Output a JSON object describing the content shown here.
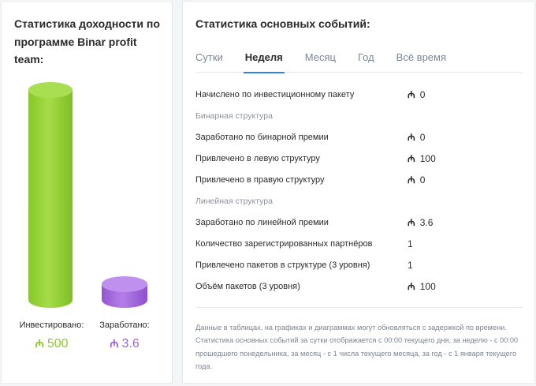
{
  "left": {
    "title": "Статистика доходности по программе Binar profit team:",
    "invested": {
      "label": "Инвестировано:",
      "value": "500",
      "color": "#8ccc2c"
    },
    "earned": {
      "label": "Заработано:",
      "value": "3.6",
      "color": "#a064d8"
    },
    "currency_symbol": "₼"
  },
  "right": {
    "title": "Статистика основных событий:",
    "tabs": [
      {
        "label": "Сутки",
        "active": false
      },
      {
        "label": "Неделя",
        "active": true
      },
      {
        "label": "Месяц",
        "active": false
      },
      {
        "label": "Год",
        "active": false
      },
      {
        "label": "Всё время",
        "active": false
      }
    ],
    "rows": [
      {
        "type": "row",
        "label": "Начислено по инвестиционному пакету",
        "value": "0",
        "currency": true
      },
      {
        "type": "section",
        "label": "Бинарная структура"
      },
      {
        "type": "row",
        "label": "Заработано по бинарной премии",
        "value": "0",
        "currency": true
      },
      {
        "type": "row",
        "label": "Привлечено в левую структуру",
        "value": "100",
        "currency": true
      },
      {
        "type": "row",
        "label": "Привлечено в правую структуру",
        "value": "0",
        "currency": true
      },
      {
        "type": "section",
        "label": "Линейная структура"
      },
      {
        "type": "row",
        "label": "Заработано по линейной премии",
        "value": "3.6",
        "currency": true
      },
      {
        "type": "row",
        "label": "Количество зарегистрированных партнёров",
        "value": "1",
        "currency": false
      },
      {
        "type": "row",
        "label": "Привлечено пакетов в структуре (3 уровня)",
        "value": "1",
        "currency": false
      },
      {
        "type": "row",
        "label": "Объём пакетов (3 уровня)",
        "value": "100",
        "currency": true
      }
    ],
    "footnote": "Данные в таблицах, на графиках и диаграммах могут обновляться с задержкой по времени. Статистика основных событий за сутки отображается с 00:00 текущего дня, за неделю - с 00:00 прошедшего понедельника, за месяц - с 1 числа текущего месяца, за год - с 1 января текущего года."
  }
}
